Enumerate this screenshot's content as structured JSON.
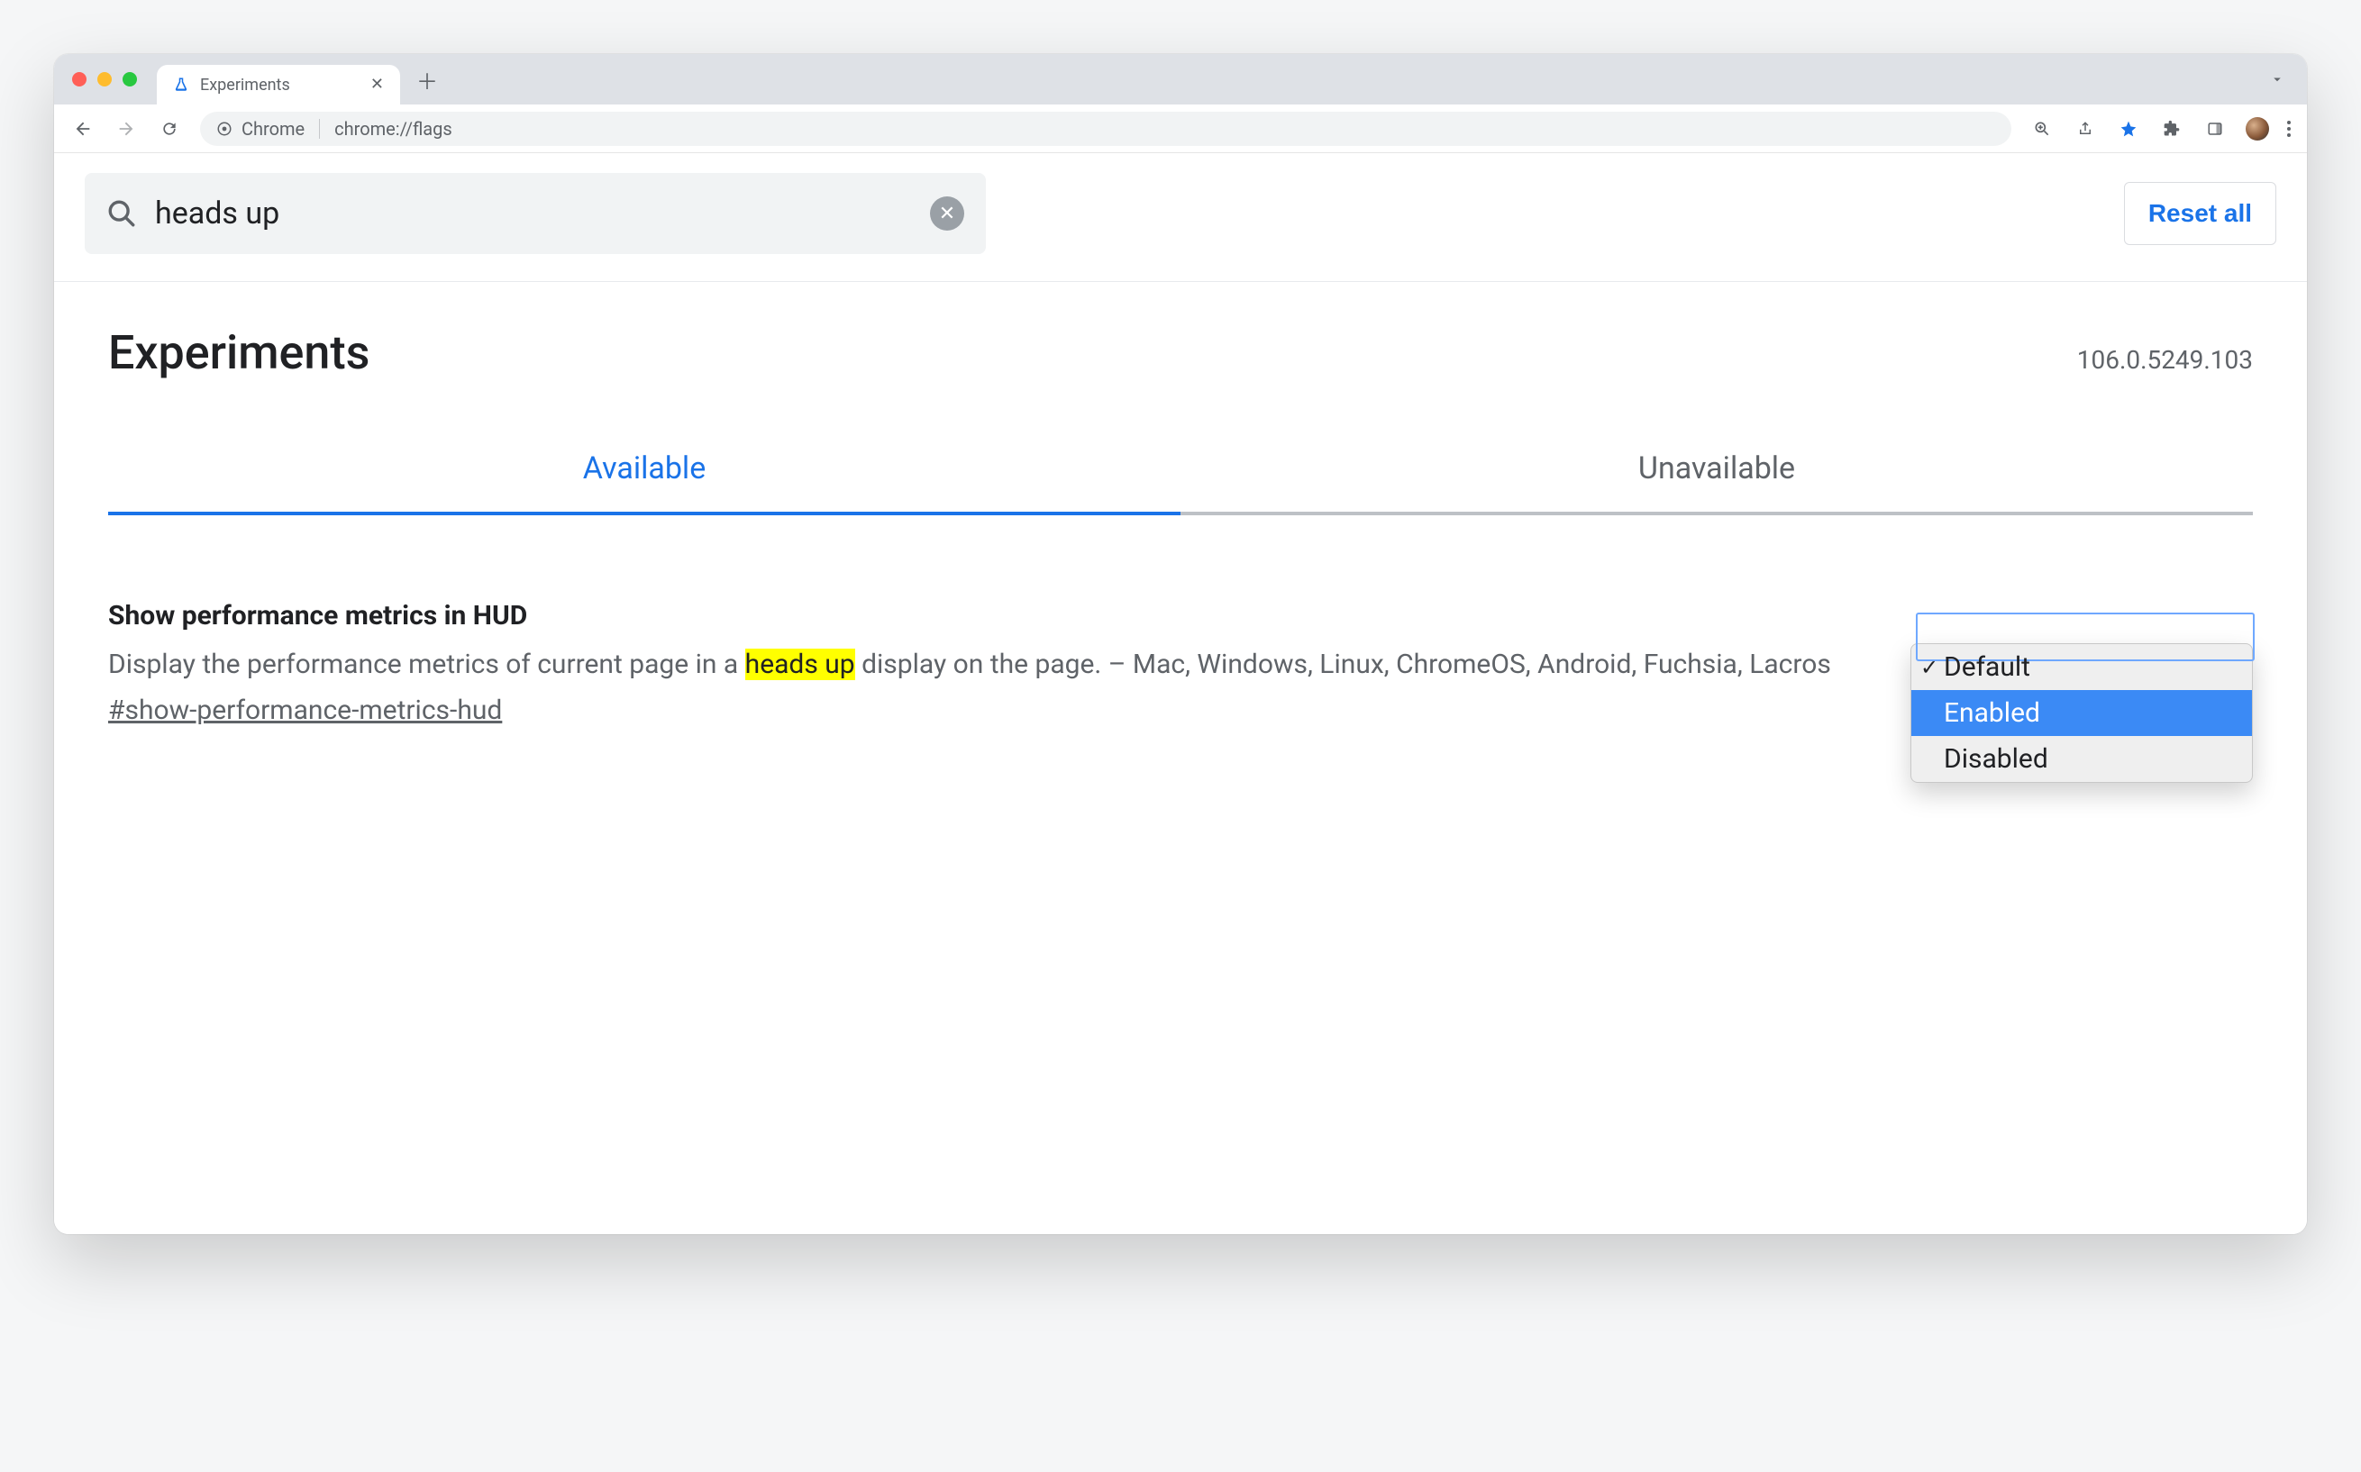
{
  "browser": {
    "tab_title": "Experiments",
    "url_scheme_label": "Chrome",
    "url": "chrome://flags"
  },
  "search": {
    "value": "heads up"
  },
  "reset_label": "Reset all",
  "page_title": "Experiments",
  "version": "106.0.5249.103",
  "tabs": {
    "available": "Available",
    "unavailable": "Unavailable"
  },
  "flag": {
    "title": "Show performance metrics in HUD",
    "desc_pre": "Display the performance metrics of current page in a ",
    "desc_hl": "heads up",
    "desc_post": " display on the page. – Mac, Windows, Linux, ChromeOS, Android, Fuchsia, Lacros",
    "anchor": "#show-performance-metrics-hud"
  },
  "dropdown": {
    "opt_default": "Default",
    "opt_enabled": "Enabled",
    "opt_disabled": "Disabled"
  }
}
